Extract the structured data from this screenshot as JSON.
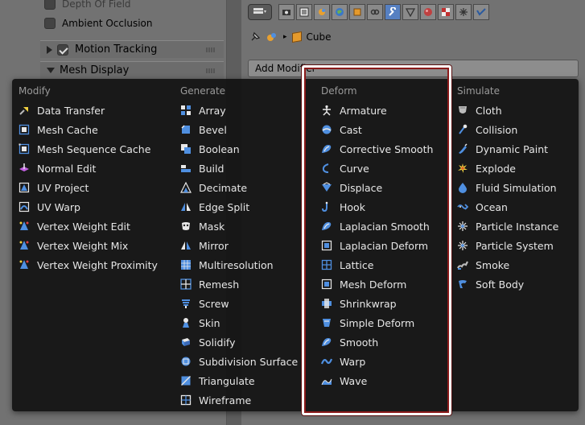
{
  "left_panel": {
    "depth_of_field": "Depth Of Field",
    "ambient_occlusion": "Ambient Occlusion",
    "motion_tracking": "Motion Tracking",
    "mesh_display": "Mesh Display"
  },
  "properties": {
    "object_name": "Cube",
    "add_modifier_label": "Add Modifier"
  },
  "menu": {
    "modify": {
      "title": "Modify",
      "items": [
        {
          "label": "Data Transfer",
          "icon": "data-transfer-icon"
        },
        {
          "label": "Mesh Cache",
          "icon": "mesh-cache-icon"
        },
        {
          "label": "Mesh Sequence Cache",
          "icon": "mesh-sequence-cache-icon"
        },
        {
          "label": "Normal Edit",
          "icon": "normal-edit-icon"
        },
        {
          "label": "UV Project",
          "icon": "uv-project-icon"
        },
        {
          "label": "UV Warp",
          "icon": "uv-warp-icon"
        },
        {
          "label": "Vertex Weight Edit",
          "icon": "vertex-weight-icon"
        },
        {
          "label": "Vertex Weight Mix",
          "icon": "vertex-weight-icon"
        },
        {
          "label": "Vertex Weight Proximity",
          "icon": "vertex-weight-icon"
        }
      ]
    },
    "generate": {
      "title": "Generate",
      "items": [
        {
          "label": "Array",
          "icon": "array-icon"
        },
        {
          "label": "Bevel",
          "icon": "bevel-icon"
        },
        {
          "label": "Boolean",
          "icon": "boolean-icon"
        },
        {
          "label": "Build",
          "icon": "build-icon"
        },
        {
          "label": "Decimate",
          "icon": "decimate-icon"
        },
        {
          "label": "Edge Split",
          "icon": "edge-split-icon"
        },
        {
          "label": "Mask",
          "icon": "mask-icon"
        },
        {
          "label": "Mirror",
          "icon": "mirror-icon"
        },
        {
          "label": "Multiresolution",
          "icon": "multiresolution-icon"
        },
        {
          "label": "Remesh",
          "icon": "remesh-icon"
        },
        {
          "label": "Screw",
          "icon": "screw-icon"
        },
        {
          "label": "Skin",
          "icon": "skin-icon"
        },
        {
          "label": "Solidify",
          "icon": "solidify-icon"
        },
        {
          "label": "Subdivision Surface",
          "icon": "subdivision-surface-icon"
        },
        {
          "label": "Triangulate",
          "icon": "triangulate-icon"
        },
        {
          "label": "Wireframe",
          "icon": "wireframe-icon"
        }
      ]
    },
    "deform": {
      "title": "Deform",
      "items": [
        {
          "label": "Armature",
          "icon": "armature-icon"
        },
        {
          "label": "Cast",
          "icon": "cast-icon"
        },
        {
          "label": "Corrective Smooth",
          "icon": "smooth-icon"
        },
        {
          "label": "Curve",
          "icon": "curve-icon"
        },
        {
          "label": "Displace",
          "icon": "displace-icon"
        },
        {
          "label": "Hook",
          "icon": "hook-icon"
        },
        {
          "label": "Laplacian Smooth",
          "icon": "smooth-icon"
        },
        {
          "label": "Laplacian Deform",
          "icon": "mesh-deform-icon"
        },
        {
          "label": "Lattice",
          "icon": "lattice-icon"
        },
        {
          "label": "Mesh Deform",
          "icon": "mesh-deform-icon"
        },
        {
          "label": "Shrinkwrap",
          "icon": "shrinkwrap-icon"
        },
        {
          "label": "Simple Deform",
          "icon": "simple-deform-icon"
        },
        {
          "label": "Smooth",
          "icon": "smooth-icon"
        },
        {
          "label": "Warp",
          "icon": "warp-icon"
        },
        {
          "label": "Wave",
          "icon": "wave-icon"
        }
      ]
    },
    "simulate": {
      "title": "Simulate",
      "items": [
        {
          "label": "Cloth",
          "icon": "cloth-icon"
        },
        {
          "label": "Collision",
          "icon": "collision-icon"
        },
        {
          "label": "Dynamic Paint",
          "icon": "dynamic-paint-icon"
        },
        {
          "label": "Explode",
          "icon": "explode-icon"
        },
        {
          "label": "Fluid Simulation",
          "icon": "fluid-icon"
        },
        {
          "label": "Ocean",
          "icon": "ocean-icon"
        },
        {
          "label": "Particle Instance",
          "icon": "particles-icon"
        },
        {
          "label": "Particle System",
          "icon": "particles-icon"
        },
        {
          "label": "Smoke",
          "icon": "smoke-icon"
        },
        {
          "label": "Soft Body",
          "icon": "soft-body-icon"
        }
      ]
    }
  },
  "colors": {
    "menu_bg": "#121212",
    "menu_text": "#e6e6e6",
    "menu_heading": "#9a9a9a",
    "icon_blue": "#4f8fe0",
    "highlight_frame": "#ffffff",
    "highlight_frame_inner": "#8b1a1a",
    "active_tab": "#5680c2"
  }
}
